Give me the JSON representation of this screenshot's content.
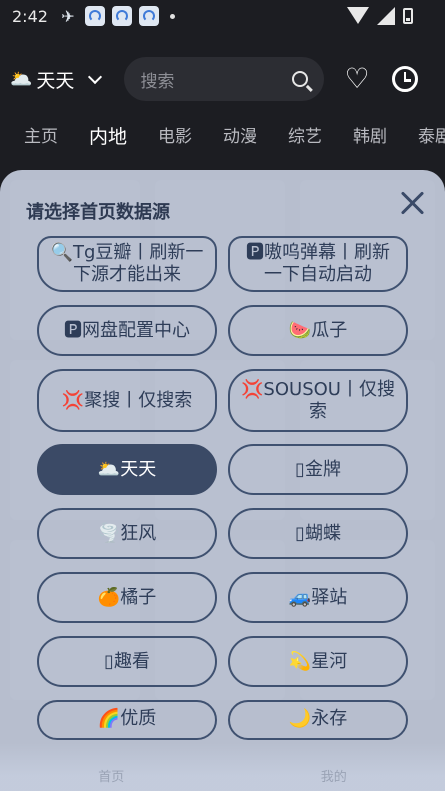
{
  "status_bar": {
    "time": "2:42"
  },
  "header": {
    "source_label": "天天",
    "source_emoji": "🌥️",
    "search_placeholder": "搜索"
  },
  "tabs": [
    {
      "label": "主页",
      "active": false
    },
    {
      "label": "内地",
      "active": true
    },
    {
      "label": "电影",
      "active": false
    },
    {
      "label": "动漫",
      "active": false
    },
    {
      "label": "综艺",
      "active": false
    },
    {
      "label": "韩剧",
      "active": false
    },
    {
      "label": "泰剧",
      "active": false
    }
  ],
  "sheet": {
    "title": "请选择首页数据源",
    "options": [
      {
        "label": "🔍Tg豆瓣丨刷新一下源才能出来",
        "selected": false
      },
      {
        "label": "🅿嗷呜弹幕丨刷新一下自动启动",
        "selected": false
      },
      {
        "label": "🅿网盘配置中心",
        "selected": false
      },
      {
        "label": "🍉瓜子",
        "selected": false
      },
      {
        "label": "💢聚搜丨仅搜索",
        "selected": false
      },
      {
        "label": "💢SOUSOU丨仅搜索",
        "selected": false
      },
      {
        "label": "🌥️天天",
        "selected": true
      },
      {
        "label": "▯金牌",
        "selected": false
      },
      {
        "label": "🌪️狂风",
        "selected": false
      },
      {
        "label": "▯蝴蝶",
        "selected": false
      },
      {
        "label": "🍊橘子",
        "selected": false
      },
      {
        "label": "🚙驿站",
        "selected": false
      },
      {
        "label": "▯趣看",
        "selected": false
      },
      {
        "label": "💫星河",
        "selected": false
      },
      {
        "label": "🌈优质",
        "selected": false
      },
      {
        "label": "🌙永存",
        "selected": false
      }
    ]
  },
  "bottom_nav": {
    "home_label": "首页",
    "mine_label": "我的"
  }
}
